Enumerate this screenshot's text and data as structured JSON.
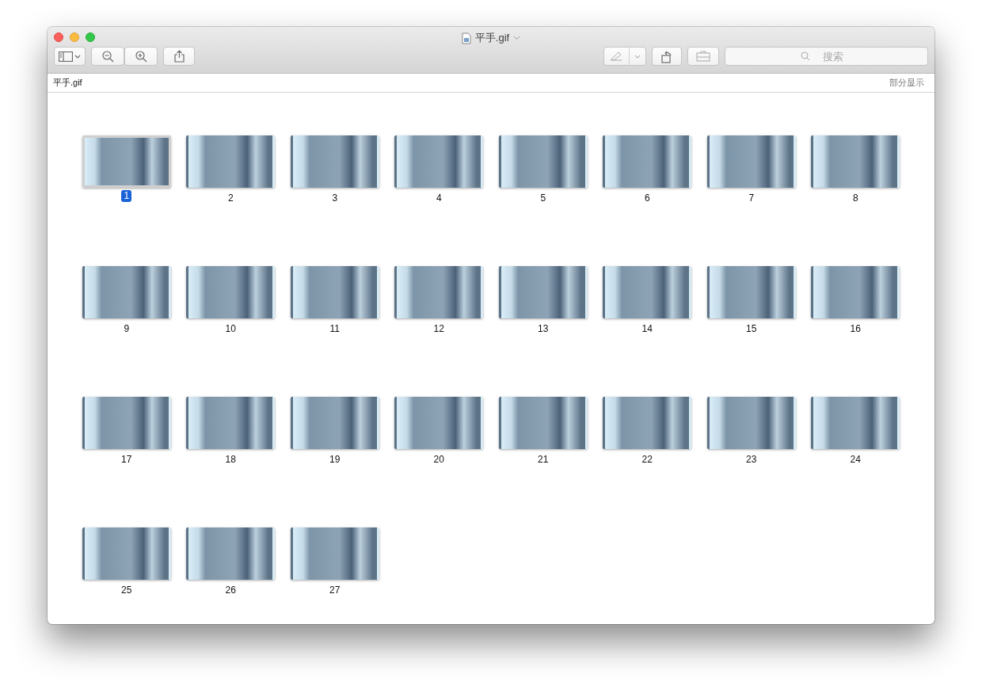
{
  "window": {
    "title": "平手.gif"
  },
  "toolbar": {
    "search": {
      "placeholder": "搜索"
    }
  },
  "header": {
    "file_name": "平手.gif",
    "display_mode": "部分显示"
  },
  "frames": [
    {
      "label": "1",
      "selected": true
    },
    {
      "label": "2",
      "selected": false
    },
    {
      "label": "3",
      "selected": false
    },
    {
      "label": "4",
      "selected": false
    },
    {
      "label": "5",
      "selected": false
    },
    {
      "label": "6",
      "selected": false
    },
    {
      "label": "7",
      "selected": false
    },
    {
      "label": "8",
      "selected": false
    },
    {
      "label": "9",
      "selected": false
    },
    {
      "label": "10",
      "selected": false
    },
    {
      "label": "11",
      "selected": false
    },
    {
      "label": "12",
      "selected": false
    },
    {
      "label": "13",
      "selected": false
    },
    {
      "label": "14",
      "selected": false
    },
    {
      "label": "15",
      "selected": false
    },
    {
      "label": "16",
      "selected": false
    },
    {
      "label": "17",
      "selected": false
    },
    {
      "label": "18",
      "selected": false
    },
    {
      "label": "19",
      "selected": false
    },
    {
      "label": "20",
      "selected": false
    },
    {
      "label": "21",
      "selected": false
    },
    {
      "label": "22",
      "selected": false
    },
    {
      "label": "23",
      "selected": false
    },
    {
      "label": "24",
      "selected": false
    },
    {
      "label": "25",
      "selected": false
    },
    {
      "label": "26",
      "selected": false
    },
    {
      "label": "27",
      "selected": false
    }
  ]
}
